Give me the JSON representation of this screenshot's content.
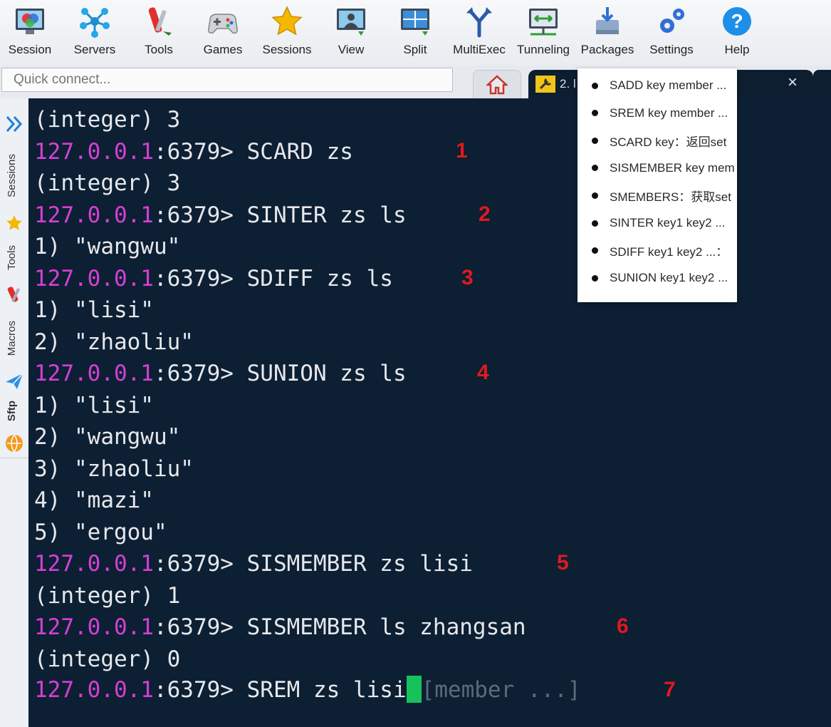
{
  "toolbar": {
    "buttons": [
      {
        "label": "Session",
        "icon": "session-icon"
      },
      {
        "label": "Servers",
        "icon": "servers-icon"
      },
      {
        "label": "Tools",
        "icon": "tools-icon"
      },
      {
        "label": "Games",
        "icon": "games-icon"
      },
      {
        "label": "Sessions",
        "icon": "sessions-star-icon"
      },
      {
        "label": "View",
        "icon": "view-icon"
      },
      {
        "label": "Split",
        "icon": "split-icon"
      },
      {
        "label": "MultiExec",
        "icon": "multiexec-icon"
      },
      {
        "label": "Tunneling",
        "icon": "tunneling-icon"
      },
      {
        "label": "Packages",
        "icon": "packages-icon"
      },
      {
        "label": "Settings",
        "icon": "settings-gear-icon"
      },
      {
        "label": "Help",
        "icon": "help-icon"
      }
    ]
  },
  "quick_connect": {
    "placeholder": "Quick connect..."
  },
  "tabs": {
    "session_tab_label": "2. l",
    "close_glyph": "×"
  },
  "sidebar": {
    "items": [
      "Sessions",
      "Tools",
      "Macros",
      "Sftp"
    ]
  },
  "terminal": {
    "lines": [
      {
        "prompt": "",
        "cmd": "(integer) 3",
        "ann": ""
      },
      {
        "prompt": "127.0.0.1",
        "port": ":6379> ",
        "cmd": "SCARD zs",
        "ann": "1"
      },
      {
        "prompt": "",
        "cmd": "(integer) 3",
        "ann": ""
      },
      {
        "prompt": "127.0.0.1",
        "port": ":6379> ",
        "cmd": "SINTER zs ls",
        "ann": "2"
      },
      {
        "prompt": "",
        "cmd": "1) \"wangwu\"",
        "ann": ""
      },
      {
        "prompt": "127.0.0.1",
        "port": ":6379> ",
        "cmd": "SDIFF zs ls",
        "ann": "3"
      },
      {
        "prompt": "",
        "cmd": "1) \"lisi\"",
        "ann": ""
      },
      {
        "prompt": "",
        "cmd": "2) \"zhaoliu\"",
        "ann": ""
      },
      {
        "prompt": "127.0.0.1",
        "port": ":6379> ",
        "cmd": "SUNION zs ls",
        "ann": "4"
      },
      {
        "prompt": "",
        "cmd": "1) \"lisi\"",
        "ann": ""
      },
      {
        "prompt": "",
        "cmd": "2) \"wangwu\"",
        "ann": ""
      },
      {
        "prompt": "",
        "cmd": "3) \"zhaoliu\"",
        "ann": ""
      },
      {
        "prompt": "",
        "cmd": "4) \"mazi\"",
        "ann": ""
      },
      {
        "prompt": "",
        "cmd": "5) \"ergou\"",
        "ann": ""
      },
      {
        "prompt": "127.0.0.1",
        "port": ":6379> ",
        "cmd": "SISMEMBER zs lisi",
        "ann": "5"
      },
      {
        "prompt": "",
        "cmd": "(integer) 1",
        "ann": ""
      },
      {
        "prompt": "127.0.0.1",
        "port": ":6379> ",
        "cmd": "SISMEMBER ls zhangsan",
        "ann": "6"
      },
      {
        "prompt": "",
        "cmd": "(integer) 0",
        "ann": ""
      }
    ],
    "current": {
      "prompt": "127.0.0.1",
      "port": ":6379> ",
      "cmd": "SREM zs lisi",
      "hint": "[member ...]",
      "ann": "7"
    }
  },
  "dropdown": {
    "items": [
      "SADD key member ...",
      "SREM key member ...",
      "SCARD key：返回set",
      "SISMEMBER key mem",
      "SMEMBERS：获取set",
      "SINTER key1 key2 ...",
      "SDIFF key1 key2 ...：",
      "SUNION key1 key2 ..."
    ]
  },
  "colors": {
    "terminal_bg": "#0d1f33",
    "prompt_ip": "#d63fd6",
    "cursor": "#17c25a",
    "annotation": "#e0191e"
  }
}
